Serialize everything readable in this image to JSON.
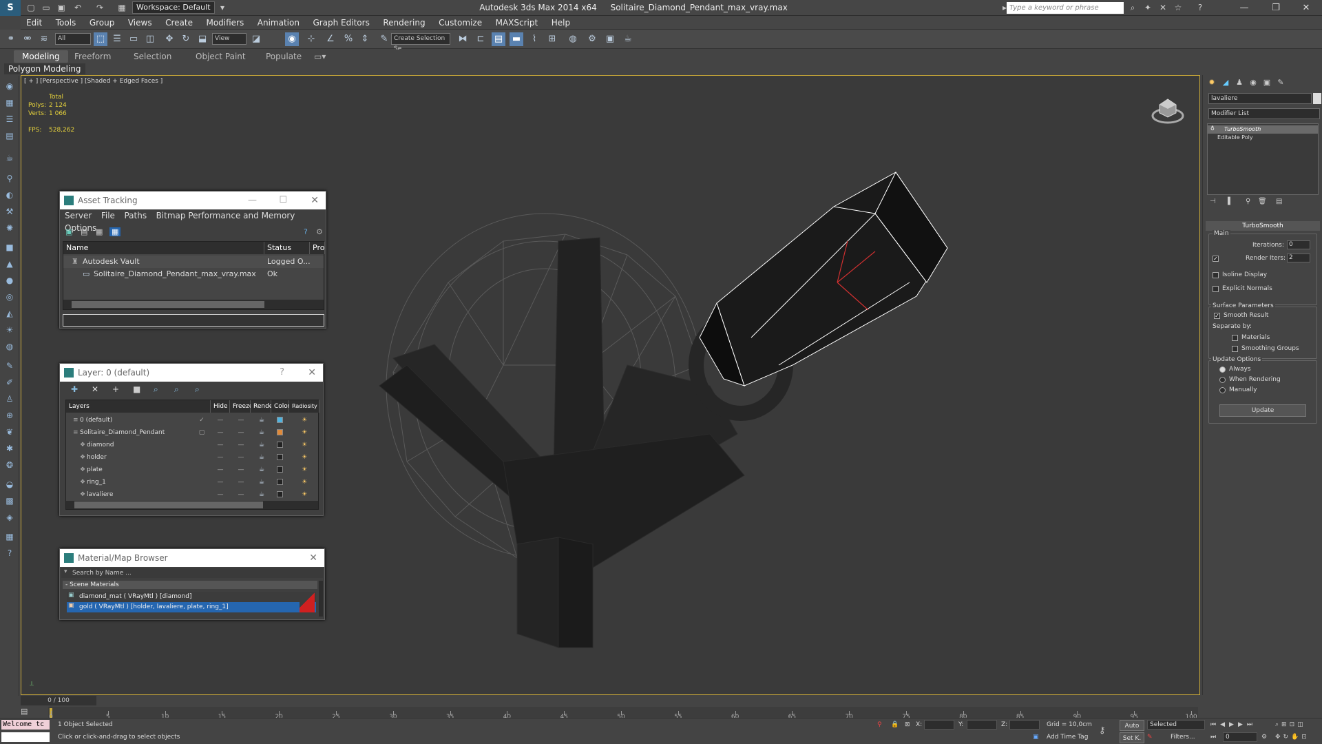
{
  "window": {
    "app": "Autodesk 3ds Max  2014 x64",
    "file": "Solitaire_Diamond_Pendant_max_vray.max",
    "workspace": "Workspace: Default",
    "search_placeholder": "Type a keyword or phrase"
  },
  "menu": [
    "Edit",
    "Tools",
    "Group",
    "Views",
    "Create",
    "Modifiers",
    "Animation",
    "Graph Editors",
    "Rendering",
    "Customize",
    "MAXScript",
    "Help"
  ],
  "toolbar": {
    "filter": "All",
    "refcoord": "View",
    "selset": "Create Selection Se"
  },
  "ribbon": {
    "tabs": [
      "Modeling",
      "Freeform",
      "Selection",
      "Object Paint",
      "Populate"
    ],
    "sub": "Polygon Modeling"
  },
  "viewport": {
    "label": "[ + ] [Perspective ] [Shaded + Edged Faces ]",
    "stats_header": "Total",
    "polys_label": "Polys:",
    "polys": "2 124",
    "verts_label": "Verts:",
    "verts": "1 066",
    "fps_label": "FPS:",
    "fps": "528,262"
  },
  "asset_tracking": {
    "title": "Asset Tracking",
    "menu": [
      "Server",
      "File",
      "Paths",
      "Bitmap Performance and Memory",
      "Options"
    ],
    "columns": [
      "Name",
      "Status",
      "Pro"
    ],
    "rows": [
      {
        "name": "Autodesk Vault",
        "status": "Logged O..."
      },
      {
        "name": "Solitaire_Diamond_Pendant_max_vray.max",
        "status": "Ok"
      }
    ]
  },
  "layer": {
    "title": "Layer: 0 (default)",
    "help": "?",
    "columns": [
      "Layers",
      "Hide",
      "Freeze",
      "Render",
      "Color",
      "Radiosity"
    ],
    "rows": [
      {
        "name": "0 (default)",
        "color": "#4fb3e0",
        "indent": 0
      },
      {
        "name": "Solitaire_Diamond_Pendant",
        "color": "#e08a3a",
        "indent": 0
      },
      {
        "name": "diamond",
        "color": "#222222",
        "indent": 1
      },
      {
        "name": "holder",
        "color": "#222222",
        "indent": 1
      },
      {
        "name": "plate",
        "color": "#222222",
        "indent": 1
      },
      {
        "name": "ring_1",
        "color": "#222222",
        "indent": 1
      },
      {
        "name": "lavaliere",
        "color": "#222222",
        "indent": 1
      }
    ]
  },
  "material_browser": {
    "title": "Material/Map Browser",
    "search_placeholder": "Search by Name ...",
    "group": "- Scene Materials",
    "items": [
      {
        "label": "diamond_mat  ( VRayMtl )  [diamond]",
        "selected": false
      },
      {
        "label": "gold  ( VRayMtl )  [holder, lavaliere, plate, ring_1]",
        "selected": true
      }
    ]
  },
  "command_panel": {
    "object_name": "lavaliere",
    "modifier_list": "Modifier List",
    "stack": [
      "TurboSmooth",
      "Editable Poly"
    ],
    "rollout": "TurboSmooth",
    "main": "Main",
    "iterations_label": "Iterations:",
    "iterations": "0",
    "render_iters_label": "Render Iters:",
    "render_iters": "2",
    "isoline": "Isoline Display",
    "explicit_normals": "Explicit Normals",
    "surface_params": "Surface Parameters",
    "smooth_result": "Smooth Result",
    "separate_by": "Separate by:",
    "materials": "Materials",
    "smoothing_groups": "Smoothing Groups",
    "update_options": "Update Options",
    "always": "Always",
    "when_rendering": "When Rendering",
    "manually": "Manually",
    "update_button": "Update"
  },
  "timeline": {
    "frame": "0 / 100",
    "ticks": [
      "0",
      "5",
      "10",
      "15",
      "20",
      "25",
      "30",
      "35",
      "40",
      "45",
      "50",
      "55",
      "60",
      "65",
      "70",
      "75",
      "80",
      "85",
      "90",
      "95",
      "100"
    ]
  },
  "status": {
    "listener": "Welcome tc",
    "selected": "1 Object Selected",
    "prompt": "Click or click-and-drag to select objects",
    "x": "X:",
    "y": "Y:",
    "z": "Z:",
    "grid": "Grid = 10,0cm",
    "auto": "Auto",
    "selected_set": "Selected",
    "setk": "Set K.",
    "filters": "Filters...",
    "add_time_tag": "Add Time Tag",
    "frame_field": "0"
  },
  "colors": {
    "accent": "#c8a838",
    "selection": "#2566b0",
    "viewport_bg": "#3a3a3a"
  }
}
